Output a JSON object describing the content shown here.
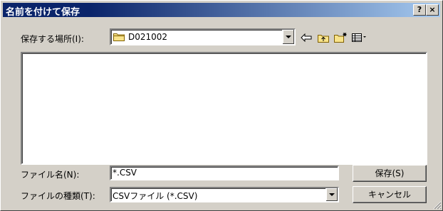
{
  "window": {
    "title": "名前を付けて保存",
    "help_button": "?",
    "close_button": "×"
  },
  "location": {
    "label": "保存する場所(I):",
    "value": "D021002"
  },
  "filename": {
    "label": "ファイル名(N):",
    "value": "*.CSV"
  },
  "filetype": {
    "label": "ファイルの種類(T):",
    "value": "CSVファイル (*.CSV)"
  },
  "buttons": {
    "save": "保存(S)",
    "cancel": "キャンセル"
  },
  "icons": [
    "folder-icon",
    "back-arrow-icon",
    "up-folder-icon",
    "new-folder-icon",
    "view-menu-icon"
  ]
}
